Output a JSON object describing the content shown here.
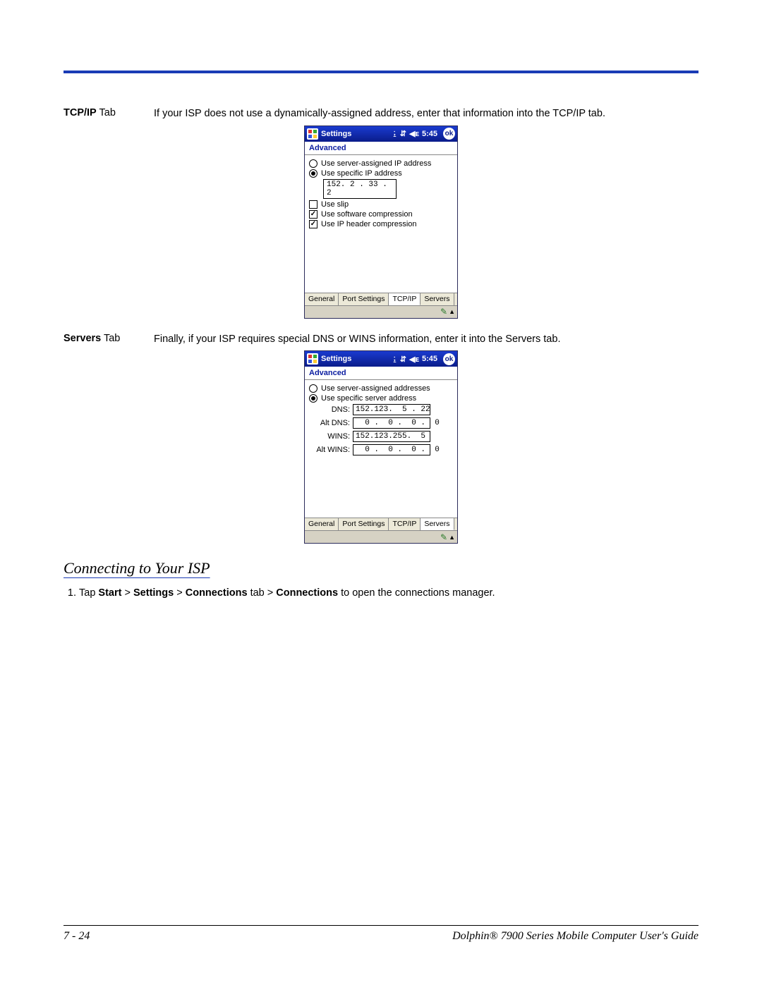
{
  "sections": {
    "tcpip": {
      "label_bold": "TCP/IP",
      "label_rest": " Tab",
      "desc": "If your ISP does not use a dynamically-assigned address, enter that information into the TCP/IP tab."
    },
    "servers": {
      "label_bold": "Servers",
      "label_rest": " Tab",
      "desc": "Finally, if your ISP requires special DNS or WINS information, enter it into the Servers tab."
    }
  },
  "wm": {
    "title": "Settings",
    "time": "5:45",
    "ok": "ok",
    "subheader": "Advanced",
    "tabs": [
      "General",
      "Port Settings",
      "TCP/IP",
      "Servers"
    ]
  },
  "tcpip_screen": {
    "radio1": "Use server-assigned IP address",
    "radio2": "Use specific IP address",
    "ip": "152.  2 . 33 .  2",
    "chk_slip": "Use slip",
    "chk_sw": "Use software compression",
    "chk_hdr": "Use IP header compression",
    "active_tab_index": 2
  },
  "servers_screen": {
    "radio1": "Use server-assigned addresses",
    "radio2": "Use specific server address",
    "fields": [
      {
        "lbl": "DNS:",
        "val": "152.123.  5 . 22"
      },
      {
        "lbl": "Alt DNS:",
        "val": "  0 .  0 .  0 .  0"
      },
      {
        "lbl": "WINS:",
        "val": "152.123.255.  5"
      },
      {
        "lbl": "Alt WINS:",
        "val": "  0 .  0 .  0 .  0"
      }
    ],
    "active_tab_index": 3
  },
  "heading": "Connecting to Your ISP",
  "step1": {
    "prefix": "Tap ",
    "p1": "Start",
    "s1": " > ",
    "p2": "Settings",
    "s2": " > ",
    "p3": "Connections",
    "s3": " tab > ",
    "p4": "Connections",
    "suffix": " to open the connections manager."
  },
  "footer": {
    "page": "7 - 24",
    "title": "Dolphin® 7900 Series Mobile Computer User's Guide"
  }
}
